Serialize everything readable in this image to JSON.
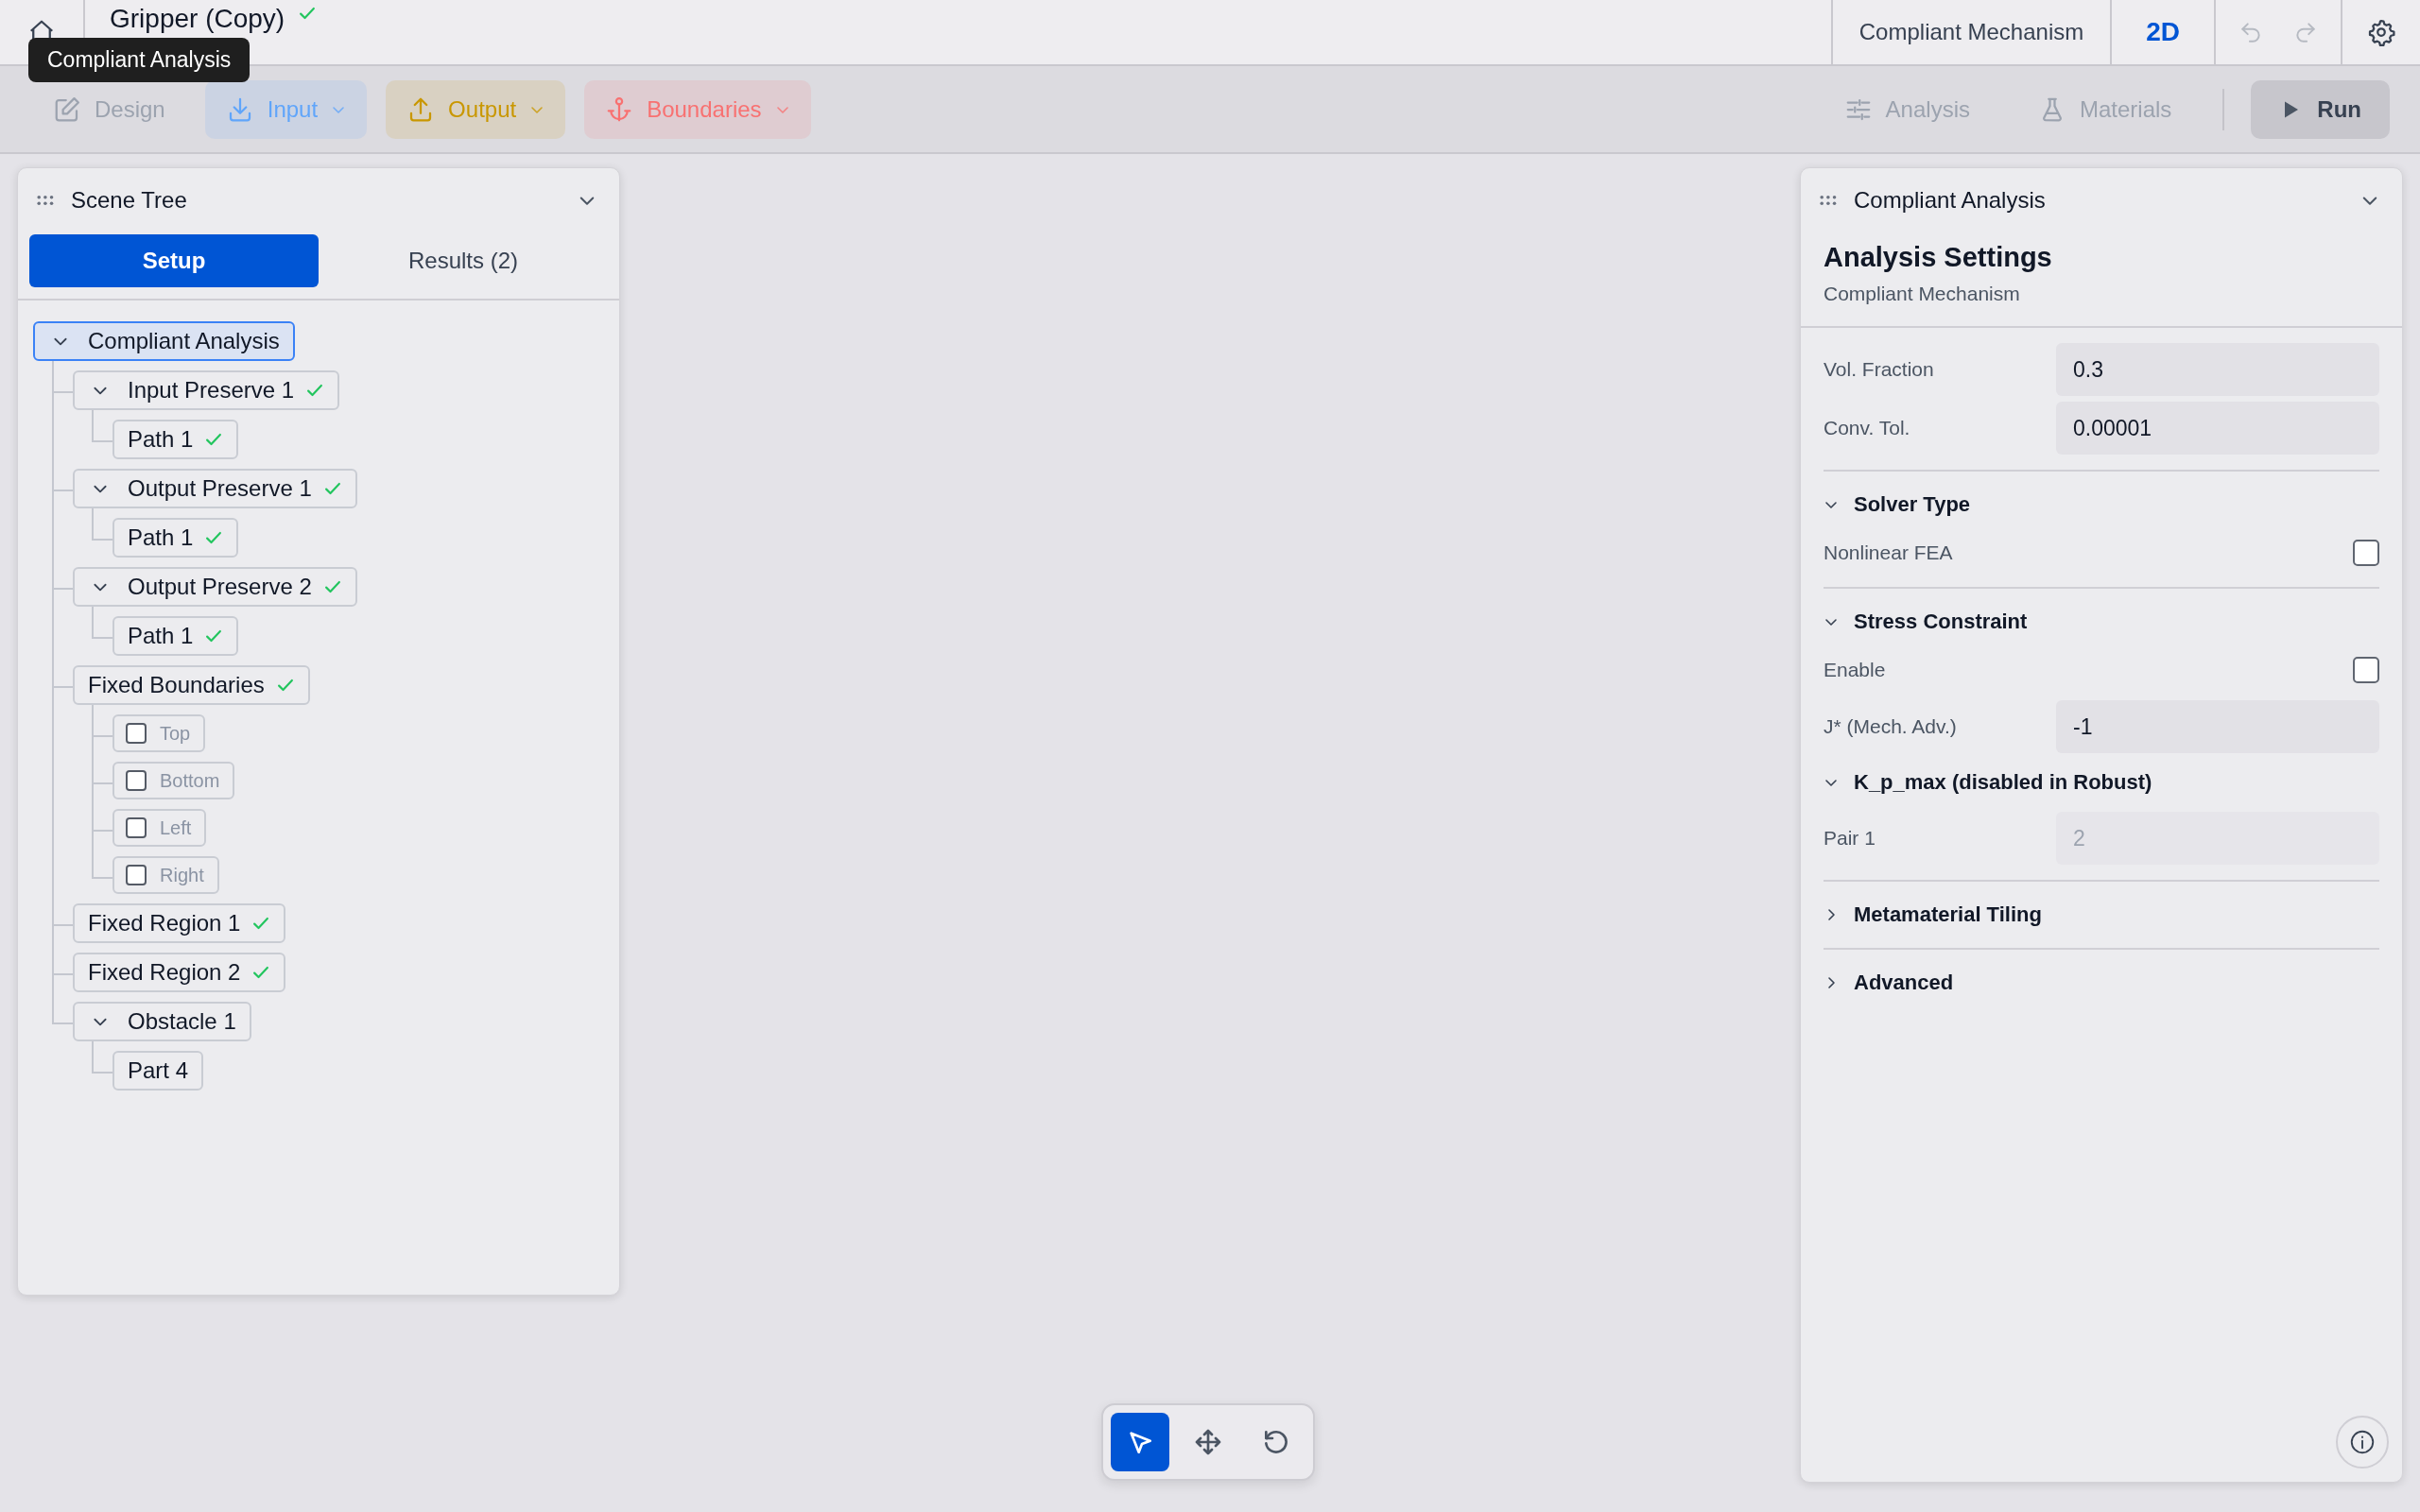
{
  "header": {
    "title": "Gripper (Copy)",
    "saved": true,
    "tooltip": "Compliant Analysis",
    "mode": "Compliant Mechanism",
    "dimension": "2D"
  },
  "toolbar": {
    "left": [
      {
        "kind": "edit",
        "label": "Design",
        "color": "#9ca3af",
        "dropdown": false
      },
      {
        "kind": "download",
        "label": "Input",
        "color": "#60a5fa",
        "dropdown": true
      },
      {
        "kind": "upload",
        "label": "Output",
        "color": "#c99700",
        "dropdown": true
      },
      {
        "kind": "anchor",
        "label": "Boundaries",
        "color": "#f87171",
        "dropdown": true
      }
    ],
    "right": [
      {
        "kind": "sliders",
        "label": "Analysis"
      },
      {
        "kind": "flask",
        "label": "Materials"
      }
    ],
    "run": "Run"
  },
  "scene_tree": {
    "title": "Scene Tree",
    "tabs": [
      {
        "label": "Setup",
        "selected": true
      },
      {
        "label": "Results (2)",
        "selected": false
      }
    ],
    "items": [
      {
        "kind": "node",
        "label": "Compliant Analysis",
        "selected": true,
        "expanded": true,
        "children": [
          {
            "kind": "node",
            "label": "Input Preserve 1",
            "selected": false,
            "expanded": true,
            "valid": true,
            "children": [
              {
                "kind": "node",
                "label": "Path 1",
                "selected": false,
                "valid": true
              }
            ]
          },
          {
            "kind": "node",
            "label": "Output Preserve 1",
            "selected": false,
            "expanded": true,
            "valid": true,
            "children": [
              {
                "kind": "node",
                "label": "Path 1",
                "selected": false,
                "valid": true
              }
            ]
          },
          {
            "kind": "node",
            "label": "Output Preserve 2",
            "selected": false,
            "expanded": true,
            "valid": true,
            "children": [
              {
                "kind": "node",
                "label": "Path 1",
                "selected": false,
                "valid": true
              }
            ]
          },
          {
            "kind": "node",
            "label": "Fixed Boundaries",
            "selected": false,
            "valid": true,
            "children": [
              {
                "kind": "checkbox",
                "label": "Top",
                "checked": false
              },
              {
                "kind": "checkbox",
                "label": "Bottom",
                "checked": false
              },
              {
                "kind": "checkbox",
                "label": "Left",
                "checked": false
              },
              {
                "kind": "checkbox",
                "label": "Right",
                "checked": false
              }
            ]
          },
          {
            "kind": "node",
            "label": "Fixed Region 1",
            "selected": false,
            "valid": true
          },
          {
            "kind": "node",
            "label": "Fixed Region 2",
            "selected": false,
            "valid": true
          },
          {
            "kind": "node",
            "label": "Obstacle 1",
            "selected": false,
            "expanded": true,
            "children": [
              {
                "kind": "node",
                "label": "Part 4",
                "selected": false
              }
            ]
          }
        ]
      }
    ]
  },
  "settings_panel": {
    "title": "Compliant Analysis",
    "heading": "Analysis Settings",
    "subtitle": "Compliant Mechanism",
    "groups": [
      [
        {
          "kind": "field",
          "label": "Vol. Fraction",
          "value": "0.3",
          "disabled": false
        },
        {
          "kind": "field",
          "label": "Conv. Tol.",
          "value": "0.00001",
          "disabled": false
        }
      ],
      [
        {
          "kind": "section",
          "label": "Solver Type",
          "expanded": true
        },
        {
          "kind": "checkbox",
          "label": "Nonlinear FEA",
          "checked": false
        }
      ],
      [
        {
          "kind": "section",
          "label": "Stress Constraint",
          "expanded": true
        },
        {
          "kind": "checkbox",
          "label": "Enable",
          "checked": false
        },
        {
          "kind": "field",
          "label": "J* (Mech. Adv.)",
          "value": "-1",
          "disabled": false
        },
        {
          "kind": "section",
          "label": "K_p_max (disabled in Robust)",
          "expanded": true
        },
        {
          "kind": "field",
          "label": "Pair 1",
          "value": "2",
          "disabled": true
        }
      ],
      [
        {
          "kind": "section",
          "label": "Metamaterial Tiling",
          "expanded": false
        }
      ],
      [
        {
          "kind": "section",
          "label": "Advanced",
          "expanded": false
        }
      ]
    ]
  },
  "canvas_tools": [
    {
      "kind": "pointer",
      "selected": true
    },
    {
      "kind": "move",
      "selected": false
    },
    {
      "kind": "rotate",
      "selected": false
    }
  ]
}
